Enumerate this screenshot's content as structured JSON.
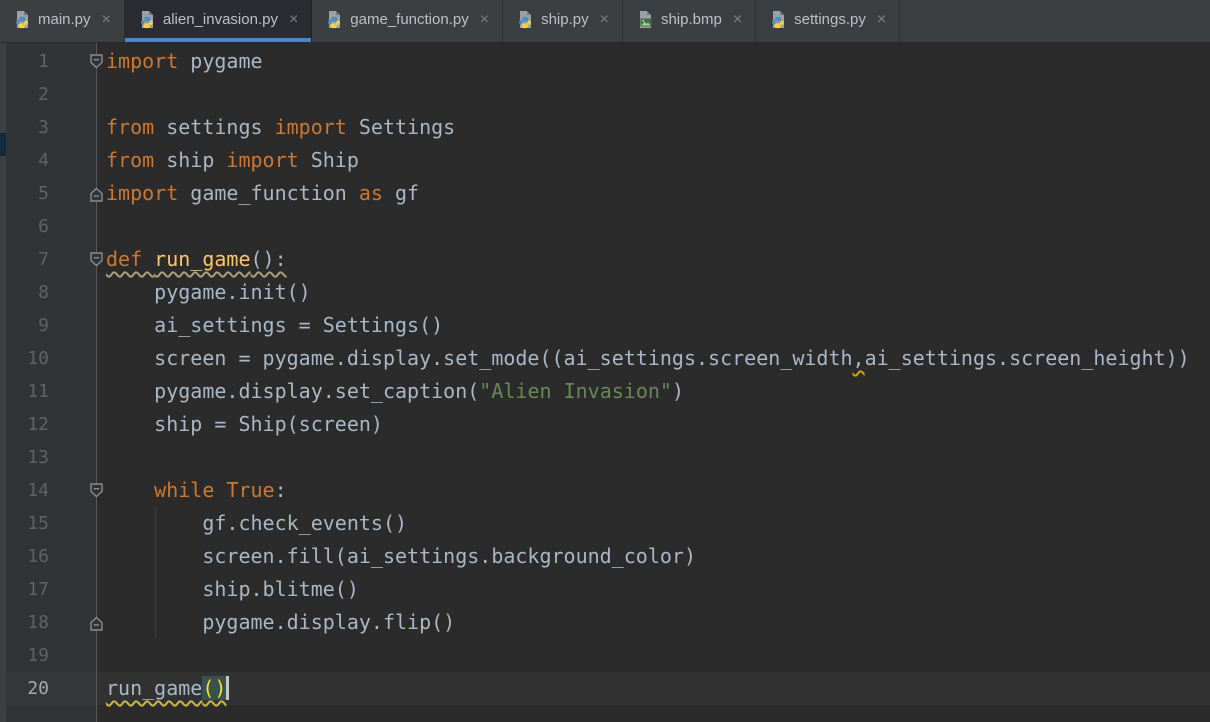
{
  "tab_bar": {
    "close_glyph": "×",
    "tabs": [
      {
        "label": "main.py",
        "type": "python",
        "active": false
      },
      {
        "label": "alien_invasion.py",
        "type": "python",
        "active": true
      },
      {
        "label": "game_function.py",
        "type": "python",
        "active": false
      },
      {
        "label": "ship.py",
        "type": "python",
        "active": false
      },
      {
        "label": "ship.bmp",
        "type": "image",
        "active": false
      },
      {
        "label": "settings.py",
        "type": "python",
        "active": false
      }
    ]
  },
  "editor": {
    "language": "python",
    "lines": [
      {
        "n": "1",
        "fold": "start",
        "tokens": [
          [
            "k",
            "import"
          ],
          [
            "t",
            " pygame"
          ]
        ]
      },
      {
        "n": "2",
        "tokens": []
      },
      {
        "n": "3",
        "tokens": [
          [
            "k",
            "from"
          ],
          [
            "t",
            " settings "
          ],
          [
            "k",
            "import"
          ],
          [
            "t",
            " Settings"
          ]
        ]
      },
      {
        "n": "4",
        "tokens": [
          [
            "k",
            "from"
          ],
          [
            "t",
            " ship "
          ],
          [
            "k",
            "import"
          ],
          [
            "t",
            " Ship"
          ]
        ]
      },
      {
        "n": "5",
        "fold": "end",
        "tokens": [
          [
            "k",
            "import"
          ],
          [
            "t",
            " game_function "
          ],
          [
            "k",
            "as"
          ],
          [
            "t",
            " gf"
          ]
        ]
      },
      {
        "n": "6",
        "tokens": []
      },
      {
        "n": "7",
        "fold": "start",
        "tokens": [
          [
            "k wg",
            "def "
          ],
          [
            "f wg",
            "run_game"
          ],
          [
            "t wg",
            "():"
          ]
        ]
      },
      {
        "n": "8",
        "tokens": [
          [
            "t",
            "    pygame.init()"
          ]
        ]
      },
      {
        "n": "9",
        "tokens": [
          [
            "t",
            "    ai_settings = Settings()"
          ]
        ]
      },
      {
        "n": "10",
        "tokens": [
          [
            "t",
            "    screen = pygame.display.set_mode((ai_settings.screen_width"
          ],
          [
            "t wo",
            ","
          ],
          [
            "t",
            "ai_settings.screen_height))"
          ]
        ]
      },
      {
        "n": "11",
        "tokens": [
          [
            "t",
            "    pygame.display.set_caption("
          ],
          [
            "s",
            "\"Alien Invasion\""
          ],
          [
            "t",
            ")"
          ]
        ]
      },
      {
        "n": "12",
        "tokens": [
          [
            "t",
            "    ship = Ship(screen)"
          ]
        ]
      },
      {
        "n": "13",
        "tokens": []
      },
      {
        "n": "14",
        "fold": "start",
        "tokens": [
          [
            "t",
            "    "
          ],
          [
            "k",
            "while"
          ],
          [
            "t",
            " "
          ],
          [
            "k",
            "True"
          ],
          [
            "t",
            ":"
          ]
        ]
      },
      {
        "n": "15",
        "tokens": [
          [
            "t",
            "        gf.check_events()"
          ]
        ]
      },
      {
        "n": "16",
        "tokens": [
          [
            "t",
            "        screen.fill(ai_settings.background_color)"
          ]
        ]
      },
      {
        "n": "17",
        "tokens": [
          [
            "t",
            "        ship.blitme()"
          ]
        ]
      },
      {
        "n": "18",
        "fold": "end",
        "tokens": [
          [
            "t",
            "        pygame.display.flip()"
          ]
        ]
      },
      {
        "n": "19",
        "tokens": []
      },
      {
        "n": "20",
        "current": true,
        "caret": true,
        "tokens": [
          [
            "t wy",
            "run_game"
          ],
          [
            "p wy",
            "()"
          ]
        ]
      }
    ]
  },
  "colors": {
    "accent_tab_underline": "#4A86C5",
    "keyword": "#CC7832",
    "function_name": "#FFC66D",
    "string": "#6A8759",
    "default_text": "#A9B7C6",
    "editor_background": "#2B2B2B",
    "gutter_background": "#313335",
    "tabbar_background": "#3C3F41",
    "line_number": "#606366",
    "matched_paren_background": "#3B514D",
    "matched_paren_text": "#F0DE3C",
    "project_selection_sliver": "#12293E"
  }
}
